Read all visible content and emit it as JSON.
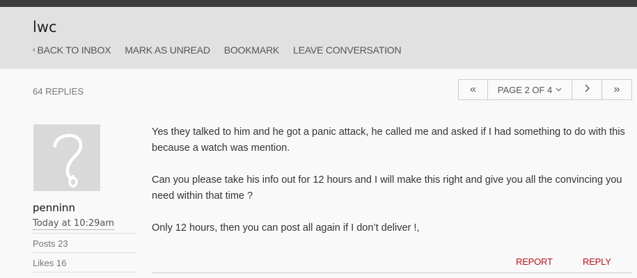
{
  "conversation": {
    "title": "lwc",
    "actions": {
      "back_to_inbox": "BACK TO INBOX",
      "mark_as_unread": "MARK AS UNREAD",
      "bookmark": "BOOKMARK",
      "leave_conversation": "LEAVE CONVERSATION"
    },
    "replies": "64 REPLIES"
  },
  "pagination": {
    "current_page": "PAGE 2 OF 4",
    "first_symbol": "«",
    "next_symbol": "›",
    "last_symbol": "»"
  },
  "post": {
    "author": "penninn",
    "time": "Today at 10:29am",
    "stats": {
      "posts": "Posts 23",
      "likes": "Likes 16"
    },
    "message": [
      "Yes they talked to him and he got a panic attack, he called me and asked if I had something to do with this because a watch was mention.",
      "Can you please take his info out for 12 hours and I will make this right and give you all the convincing you need within that time ?",
      "Only 12 hours, then you can post all again if I don’t deliver !,"
    ],
    "report_label": "REPORT",
    "reply_label": "REPLY"
  },
  "colors": {
    "header_bg": "#e1e1e1",
    "topbar_bg": "#3d3d3d",
    "accent_red": "#b2151b"
  },
  "icons": {
    "avatar": "question-mark-avatar-icon",
    "back": "chevron-left-icon",
    "dropdown": "chevron-down-icon"
  }
}
